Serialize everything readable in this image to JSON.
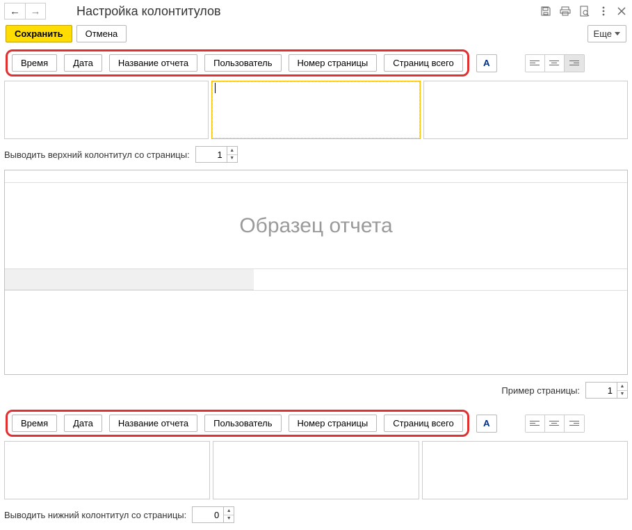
{
  "title": "Настройка колонтитулов",
  "toolbar": {
    "save": "Сохранить",
    "cancel": "Отмена",
    "more": "Еще"
  },
  "insert": {
    "time": "Время",
    "date": "Дата",
    "report_name": "Название отчета",
    "user": "Пользователь",
    "page_number": "Номер страницы",
    "pages_total": "Страниц всего",
    "font": "A"
  },
  "labels": {
    "output_header_from": "Выводить верхний колонтитул со страницы:",
    "output_footer_from": "Выводить нижний колонтитул со страницы:",
    "sample_page": "Пример страницы:",
    "sample_report": "Образец отчета"
  },
  "values": {
    "header_page": "1",
    "footer_page": "0",
    "sample_page": "1"
  }
}
